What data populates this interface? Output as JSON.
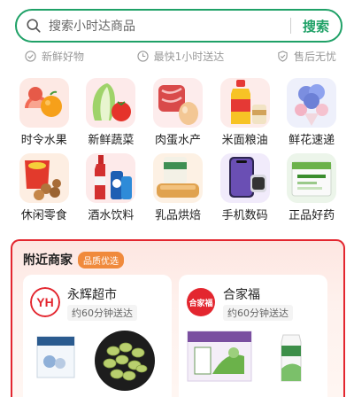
{
  "search": {
    "placeholder": "搜索小时达商品",
    "button_label": "搜索",
    "accent": "#1fa167"
  },
  "guarantees": [
    {
      "icon": "check-circle-icon",
      "label": "新鲜好物"
    },
    {
      "icon": "clock-icon",
      "label": "最快1小时送达"
    },
    {
      "icon": "shield-check-icon",
      "label": "售后无忧"
    }
  ],
  "categories": [
    {
      "label": "时令水果",
      "icon": "fruit-icon"
    },
    {
      "label": "新鲜蔬菜",
      "icon": "vegetable-icon"
    },
    {
      "label": "肉蛋水产",
      "icon": "meat-egg-icon"
    },
    {
      "label": "米面粮油",
      "icon": "grain-oil-icon"
    },
    {
      "label": "鲜花速递",
      "icon": "flower-icon"
    },
    {
      "label": "休闲零食",
      "icon": "snack-icon"
    },
    {
      "label": "酒水饮料",
      "icon": "drinks-icon"
    },
    {
      "label": "乳品烘焙",
      "icon": "dairy-bakery-icon"
    },
    {
      "label": "手机数码",
      "icon": "phone-digital-icon"
    },
    {
      "label": "正品好药",
      "icon": "medicine-icon"
    }
  ],
  "nearby": {
    "title": "附近商家",
    "tag": "品质优选",
    "border_color": "#e3262f",
    "stores": [
      {
        "name": "永辉超市",
        "logo_text": "YH",
        "eta": "约60分钟送达"
      },
      {
        "name": "合家福",
        "logo_text": "合家福",
        "eta": "约60分钟送达"
      }
    ]
  }
}
